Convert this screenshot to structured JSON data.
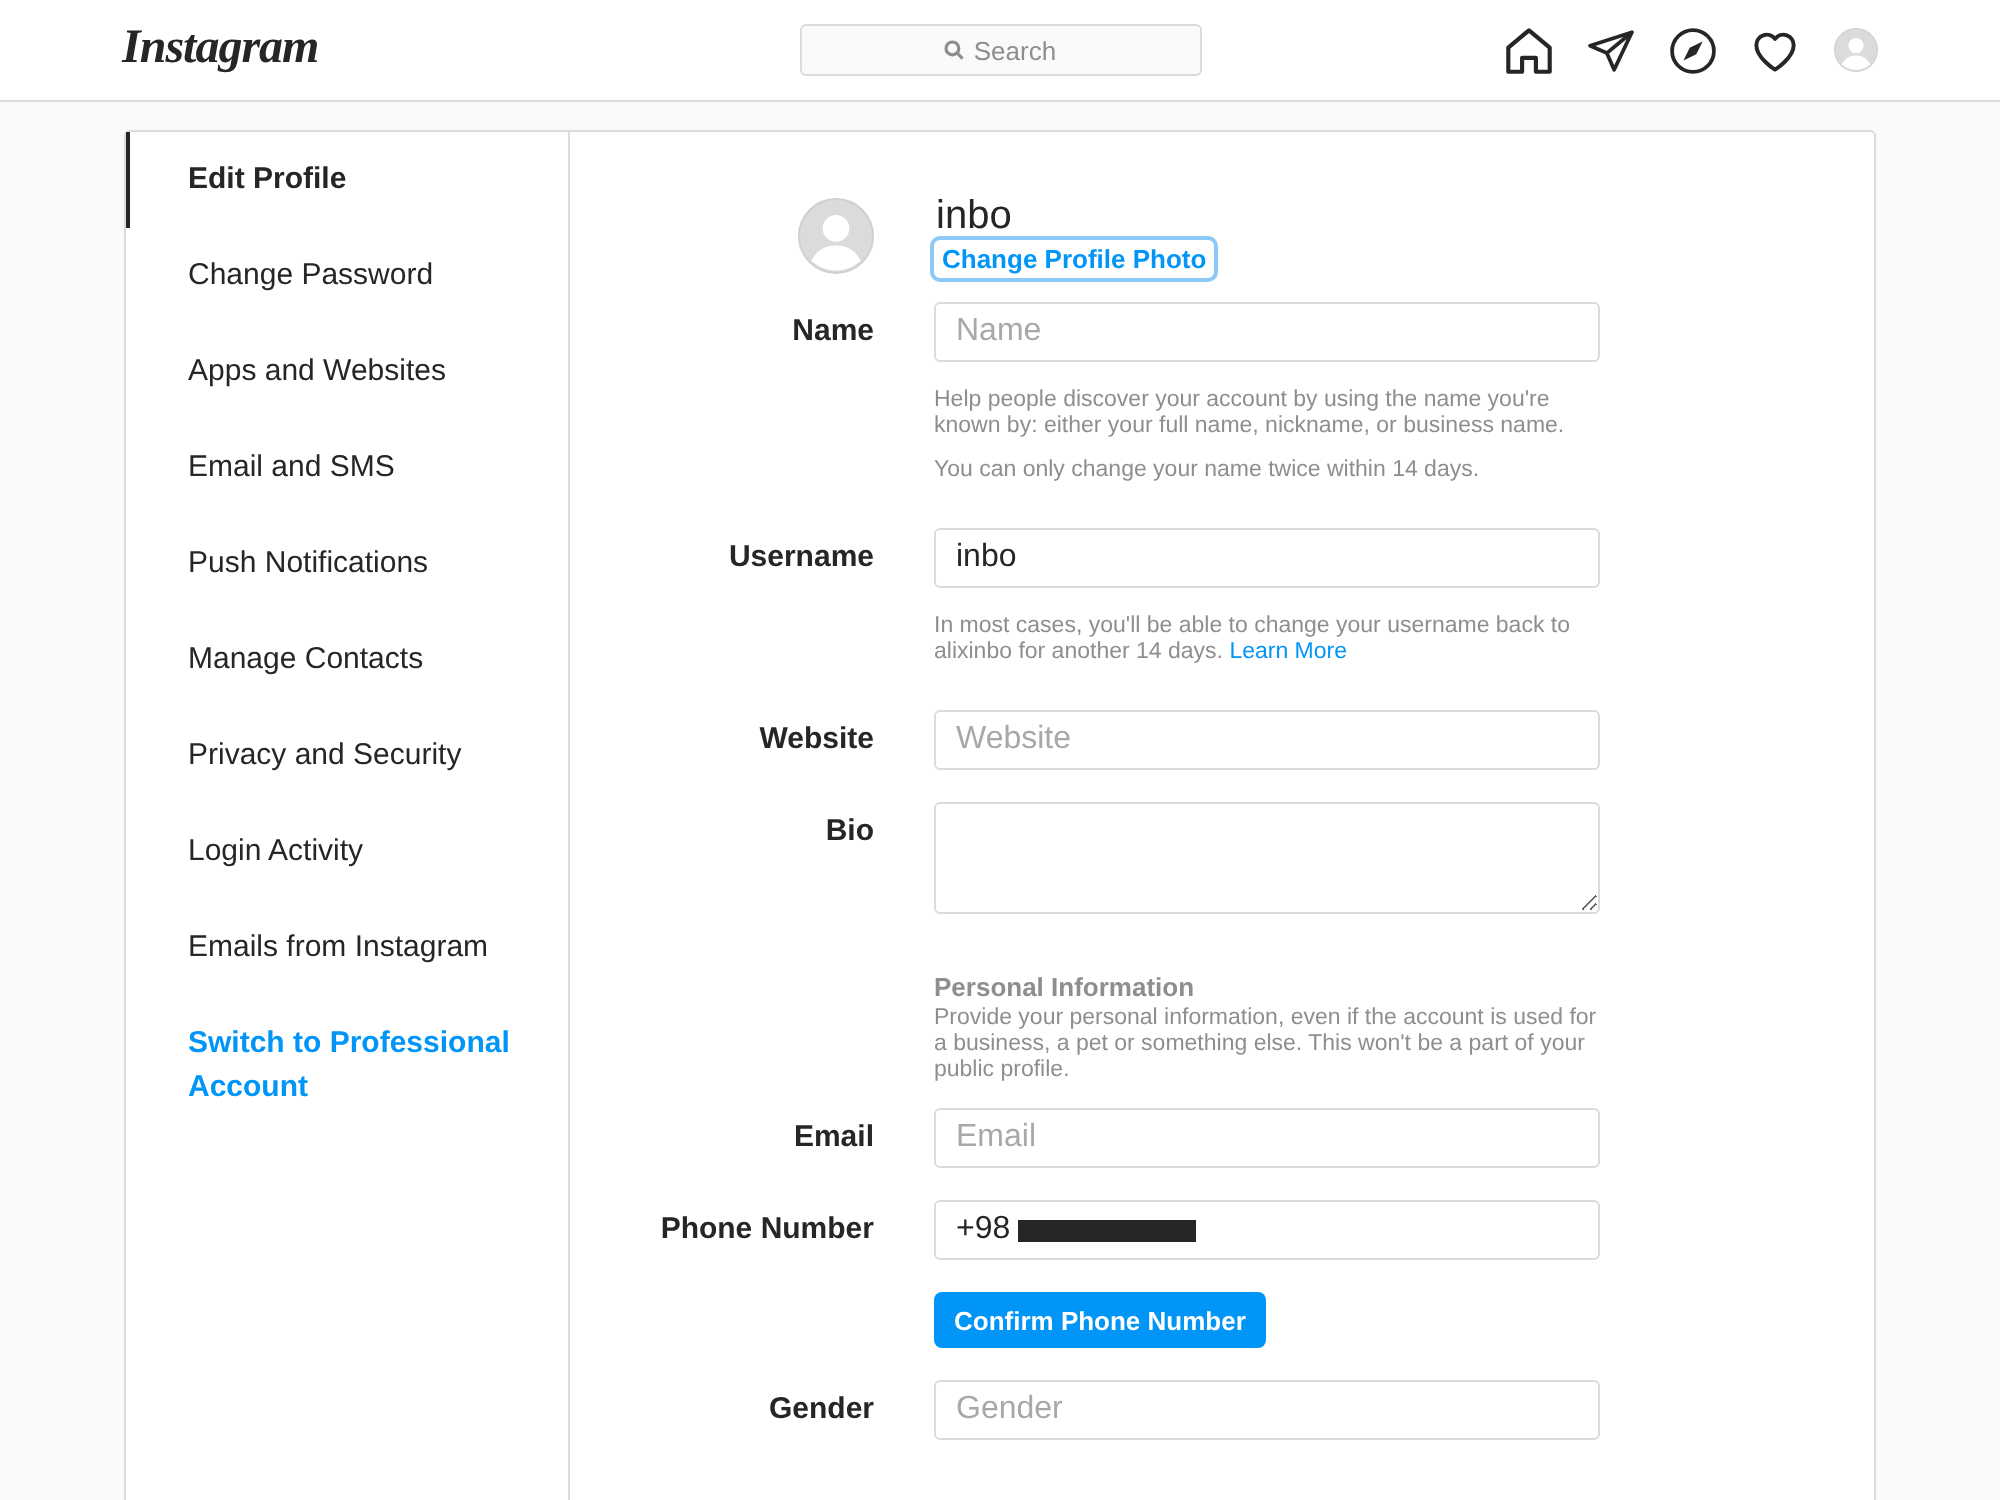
{
  "header": {
    "logo": "Instagram",
    "search": {
      "placeholder": "Search"
    }
  },
  "sidebar": {
    "items": [
      {
        "label": "Edit Profile",
        "selected": true,
        "kind": "page"
      },
      {
        "label": "Change Password",
        "selected": false,
        "kind": "page"
      },
      {
        "label": "Apps and Websites",
        "selected": false,
        "kind": "page"
      },
      {
        "label": "Email and SMS",
        "selected": false,
        "kind": "page"
      },
      {
        "label": "Push Notifications",
        "selected": false,
        "kind": "page"
      },
      {
        "label": "Manage Contacts",
        "selected": false,
        "kind": "page"
      },
      {
        "label": "Privacy and Security",
        "selected": false,
        "kind": "page"
      },
      {
        "label": "Login Activity",
        "selected": false,
        "kind": "page"
      },
      {
        "label": "Emails from Instagram",
        "selected": false,
        "kind": "page"
      },
      {
        "label": "Switch to Professional Account",
        "selected": false,
        "kind": "link"
      }
    ]
  },
  "profile": {
    "username": "inbo",
    "change_photo": {
      "label": "Change Profile Photo",
      "focused": true
    }
  },
  "form": {
    "fields": [
      {
        "kind": "input",
        "label": "Name",
        "placeholder": "Name",
        "help": [
          "Help people discover your account by using the name you're known by: either your full name, nickname, or business name.",
          "You can only change your name twice within 14 days."
        ]
      },
      {
        "kind": "input",
        "label": "Username",
        "value": "inbo",
        "help": [
          "In most cases, you'll be able to change your username back to alixinbo for another 14 days."
        ],
        "help_link": "Learn More"
      },
      {
        "kind": "input",
        "label": "Website",
        "placeholder": "Website"
      },
      {
        "kind": "textarea",
        "label": "Bio"
      },
      {
        "kind": "section",
        "title": "Personal Information",
        "text": "Provide your personal information, even if the account is used for a business, a pet or something else. This won't be a part of your public profile."
      },
      {
        "kind": "input",
        "label": "Email",
        "placeholder": "Email"
      },
      {
        "kind": "input",
        "label": "Phone Number",
        "value": "+98",
        "redacted": true
      },
      {
        "kind": "button",
        "label": "Confirm Phone Number"
      },
      {
        "kind": "input",
        "label": "Gender",
        "placeholder": "Gender"
      }
    ]
  }
}
